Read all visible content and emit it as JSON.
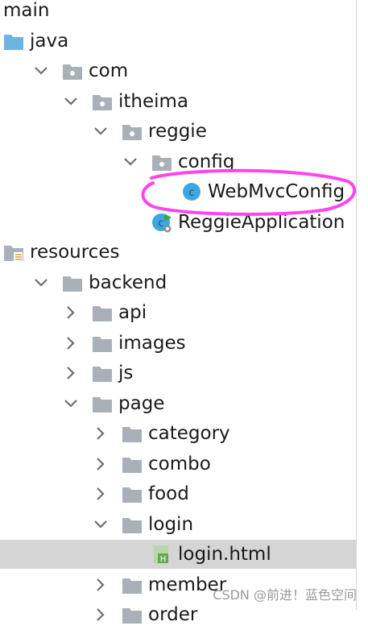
{
  "tree": {
    "items": [
      {
        "label": "main",
        "depth": -1,
        "arrow": "none",
        "icon": "none"
      },
      {
        "label": "java",
        "depth": 0,
        "arrow": "none",
        "icon": "source-folder-icon"
      },
      {
        "label": "com",
        "depth": 1,
        "arrow": "expanded",
        "icon": "package-icon"
      },
      {
        "label": "itheima",
        "depth": 2,
        "arrow": "expanded",
        "icon": "package-icon"
      },
      {
        "label": "reggie",
        "depth": 3,
        "arrow": "expanded",
        "icon": "package-icon"
      },
      {
        "label": "config",
        "depth": 4,
        "arrow": "expanded",
        "icon": "package-icon"
      },
      {
        "label": "WebMvcConfig",
        "depth": 5,
        "arrow": "none",
        "icon": "java-class-icon"
      },
      {
        "label": "ReggieApplication",
        "depth": 4,
        "arrow": "none",
        "icon": "spring-boot-app-icon"
      },
      {
        "label": "resources",
        "depth": 0,
        "arrow": "none",
        "icon": "resources-folder-icon"
      },
      {
        "label": "backend",
        "depth": 1,
        "arrow": "expanded",
        "icon": "folder-icon"
      },
      {
        "label": "api",
        "depth": 2,
        "arrow": "collapsed",
        "icon": "folder-icon"
      },
      {
        "label": "images",
        "depth": 2,
        "arrow": "collapsed",
        "icon": "folder-icon"
      },
      {
        "label": "js",
        "depth": 2,
        "arrow": "collapsed",
        "icon": "folder-icon"
      },
      {
        "label": "page",
        "depth": 2,
        "arrow": "expanded",
        "icon": "folder-icon"
      },
      {
        "label": "category",
        "depth": 3,
        "arrow": "collapsed",
        "icon": "folder-icon"
      },
      {
        "label": "combo",
        "depth": 3,
        "arrow": "collapsed",
        "icon": "folder-icon"
      },
      {
        "label": "food",
        "depth": 3,
        "arrow": "collapsed",
        "icon": "folder-icon"
      },
      {
        "label": "login",
        "depth": 3,
        "arrow": "expanded",
        "icon": "folder-icon"
      },
      {
        "label": "login.html",
        "depth": 4,
        "arrow": "none",
        "icon": "html-file-icon",
        "selected": true
      },
      {
        "label": "member",
        "depth": 3,
        "arrow": "collapsed",
        "icon": "folder-icon"
      },
      {
        "label": "order",
        "depth": 3,
        "arrow": "collapsed",
        "icon": "folder-icon"
      }
    ]
  },
  "watermark": "CSDN @前进！蓝色空间",
  "colors": {
    "folder": "#a9b0b8",
    "package_dot": "#ffffff",
    "source_folder": "#6cb4e3",
    "java_class": "#3fa7e0",
    "annotation": "#ff44ee",
    "selected_row": "#d5d5d5"
  }
}
